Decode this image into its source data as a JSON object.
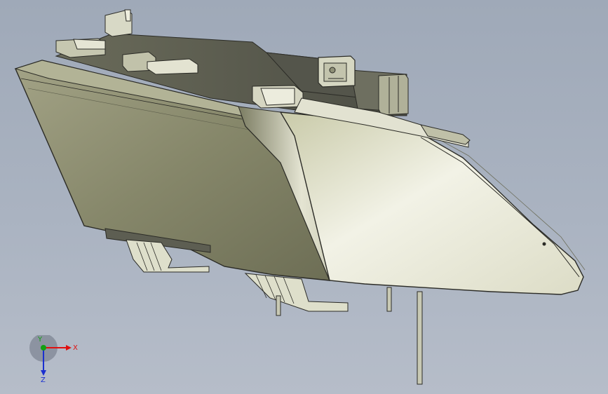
{
  "viewport": {
    "background_top": "#9fa9b8",
    "background_bottom": "#b6bdc9"
  },
  "model": {
    "body_color": "#8f9072",
    "lens_color": "#d9dac4",
    "housing_color": "#5a5b52",
    "edge_color": "#2b2b26"
  },
  "triad": {
    "x_label": "X",
    "y_label": "Y",
    "z_label": "Z",
    "x_color": "#e01010",
    "y_color": "#12a012",
    "z_color": "#1a2fd0"
  }
}
